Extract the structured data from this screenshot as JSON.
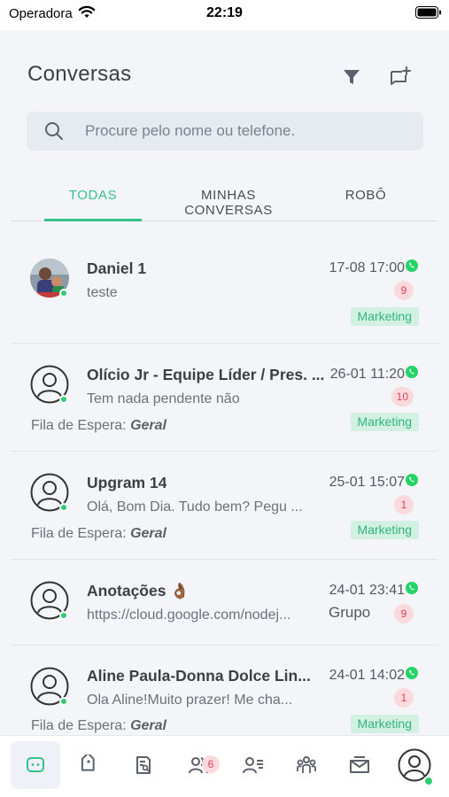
{
  "status_bar": {
    "carrier": "Operadora",
    "time": "22:19"
  },
  "header": {
    "title": "Conversas",
    "filter_icon": "filter-icon",
    "new_chat_icon": "new-chat-icon"
  },
  "search": {
    "placeholder": "Procure pelo nome ou telefone."
  },
  "tabs": [
    {
      "label": "TODAS",
      "active": true
    },
    {
      "label": "MINHAS CONVERSAS",
      "active": false
    },
    {
      "label": "ROBÔ",
      "active": false
    }
  ],
  "conversations": [
    {
      "name": "Daniel 1",
      "time": "17-08 17:00",
      "preview": "teste",
      "unread": "9",
      "tag": "Marketing",
      "queue_label": "",
      "queue_value": "",
      "extra": ""
    },
    {
      "name": "Olício Jr - Equipe Líder / Pres. ...",
      "time": "26-01 11:20",
      "preview": "Tem nada pendente não",
      "unread": "10",
      "tag": "Marketing",
      "queue_label": "Fila de Espera:",
      "queue_value": "Geral",
      "extra": ""
    },
    {
      "name": "Upgram 14",
      "time": "25-01 15:07",
      "preview": "Olá, Bom Dia. Tudo bem?  Pegu ...",
      "unread": "1",
      "tag": "Marketing",
      "queue_label": "Fila de Espera:",
      "queue_value": "Geral",
      "extra": ""
    },
    {
      "name": "Anotações 👌🏾",
      "time": "24-01 23:41",
      "preview": "https://cloud.google.com/nodej...",
      "unread": "9",
      "tag": "",
      "queue_label": "",
      "queue_value": "",
      "extra": "Grupo"
    },
    {
      "name": "Aline Paula-Donna Dolce Lin...",
      "time": "24-01 14:02",
      "preview": "Ola Aline!Muito prazer! Me cha...",
      "unread": "1",
      "tag": "Marketing",
      "queue_label": "Fila de Espera:",
      "queue_value": "Geral",
      "extra": ""
    }
  ],
  "bottom_nav": {
    "items": [
      "chat-icon",
      "tag-icon",
      "report-icon",
      "contacts-icon",
      "user-list-icon",
      "groups-icon",
      "mail-icon",
      "profile-icon"
    ],
    "contacts_badge": "6"
  },
  "colors": {
    "accent": "#35c28a",
    "badge_bg": "#fbd9dd",
    "badge_text": "#e2405a",
    "whatsapp": "#25d366"
  }
}
